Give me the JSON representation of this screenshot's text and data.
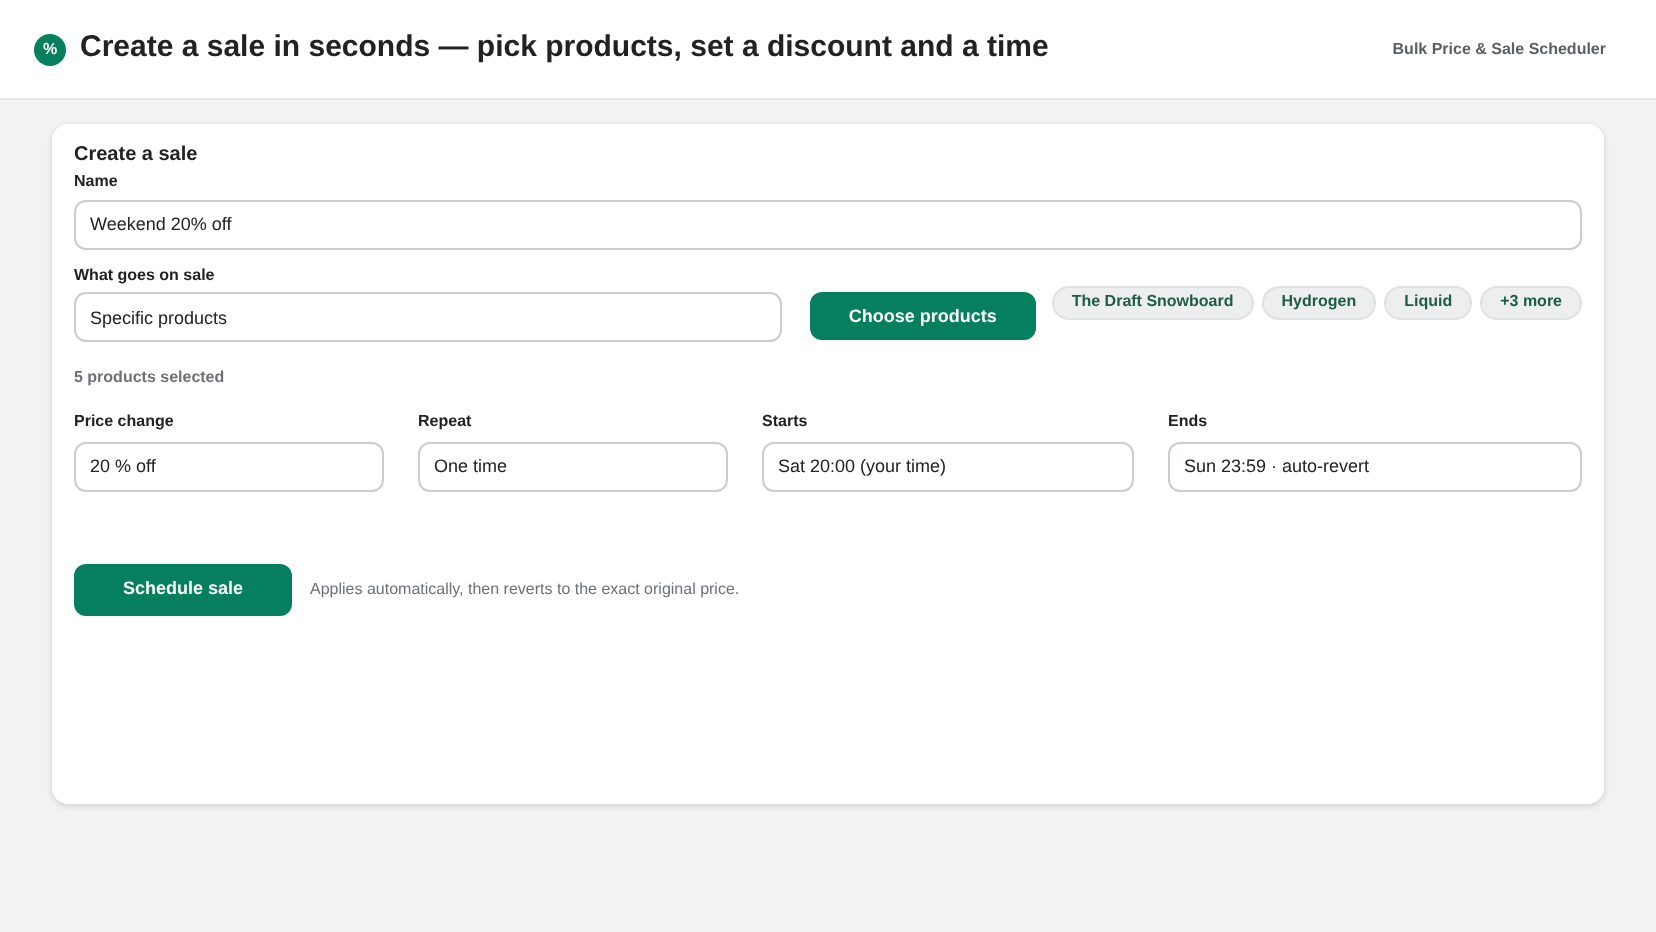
{
  "header": {
    "logo": "%",
    "title": "Create a sale in seconds — pick products, set a discount and a time",
    "app_name": "Bulk Price & Sale Scheduler"
  },
  "card": {
    "title": "Create a sale",
    "name_field": {
      "label": "Name",
      "value": "Weekend 20% off"
    },
    "scope_field": {
      "label": "What goes on sale",
      "value": "Specific products"
    },
    "choose_button": "Choose products",
    "chips": [
      "The Draft Snowboard",
      "Hydrogen",
      "Liquid",
      "+3 more"
    ],
    "selection_note": "5 products selected",
    "fields": [
      {
        "label": "Price change",
        "value": "20 % off"
      },
      {
        "label": "Repeat",
        "value": "One time"
      },
      {
        "label": "Starts",
        "value": "Sat 20:00 (your time)"
      },
      {
        "label": "Ends",
        "value": "Sun 23:59 · auto-revert"
      }
    ],
    "submit_button": "Schedule sale",
    "hint": "Applies automatically, then reverts to the exact original price."
  }
}
